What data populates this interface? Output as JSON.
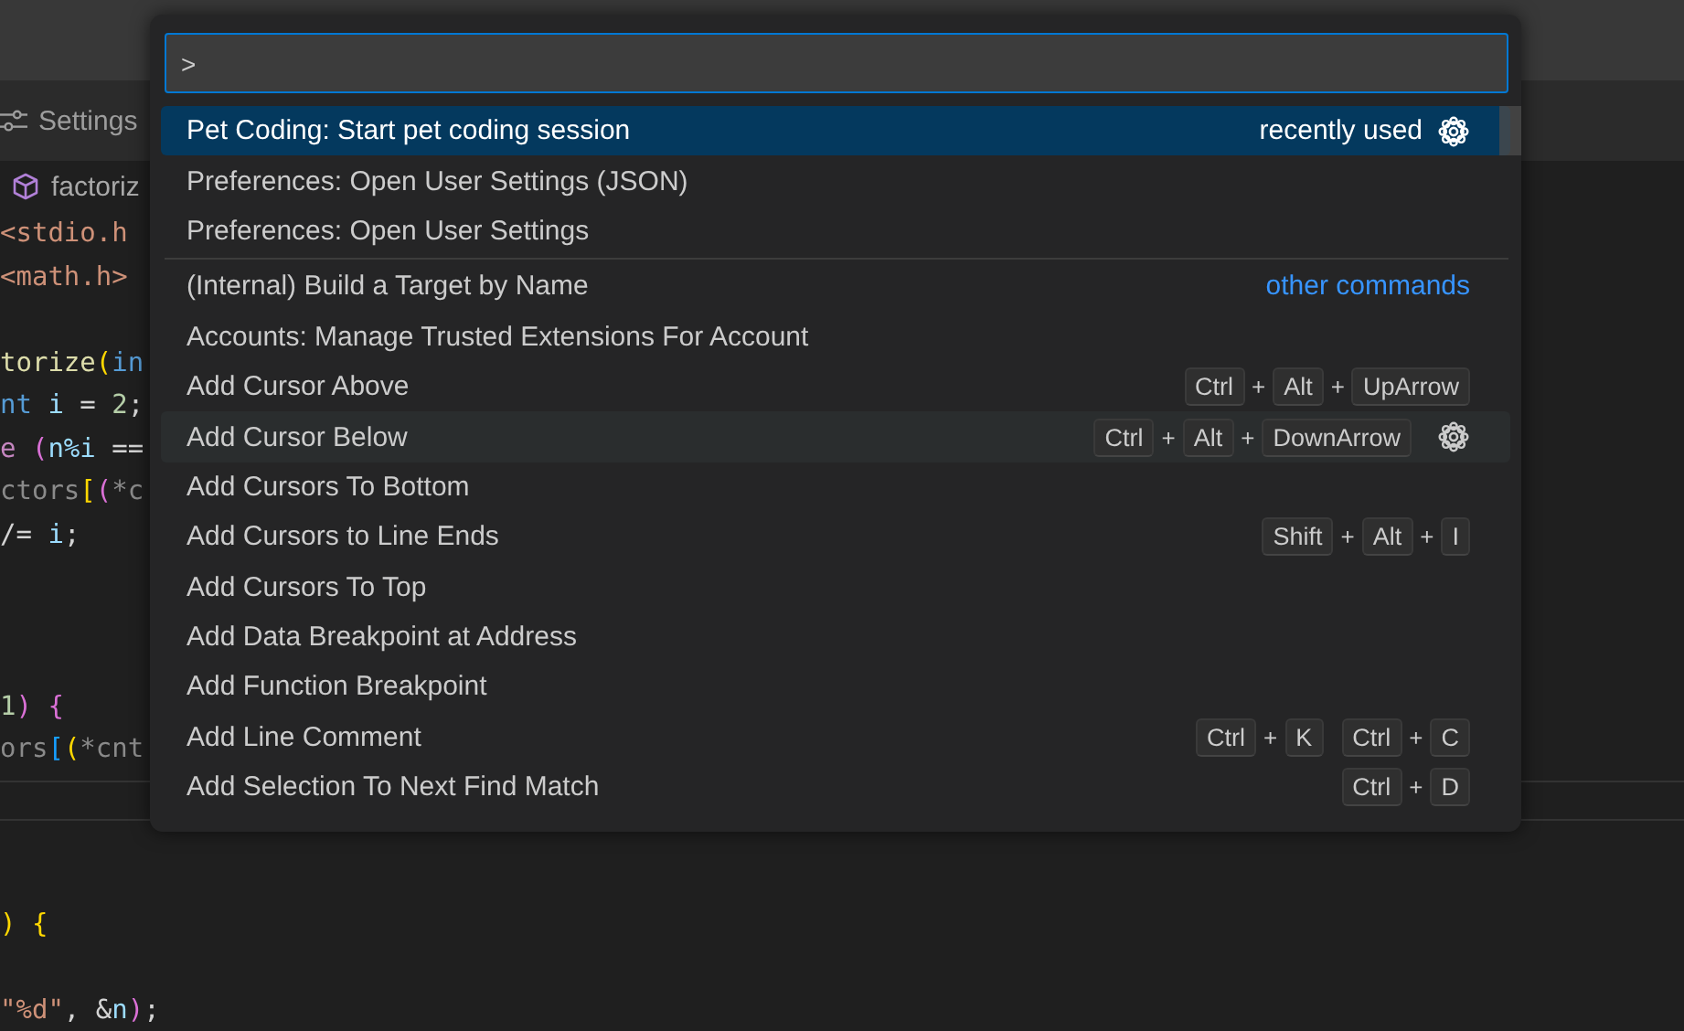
{
  "tab_bar": {
    "tabs": [
      {
        "label": "Settings",
        "selected": false
      }
    ]
  },
  "breadcrumb": {
    "file": "factoriz"
  },
  "editor": {
    "lines_top": [
      {
        "kind": "code",
        "tokens": [
          {
            "text": "<stdio.h",
            "kind": "string"
          }
        ]
      },
      {
        "kind": "code",
        "tokens": [
          {
            "text": "<math.h>",
            "kind": "string"
          }
        ]
      },
      {
        "kind": "blank"
      },
      {
        "kind": "code",
        "tokens": [
          {
            "text": "torize",
            "kind": "function"
          },
          {
            "text": "(",
            "kind": "bracket1"
          },
          {
            "text": "in",
            "kind": "keyword"
          }
        ]
      },
      {
        "kind": "code",
        "tokens": [
          {
            "text": "nt",
            "kind": "keyword"
          },
          {
            "text": " i",
            "kind": "variable"
          },
          {
            "text": " = ",
            "kind": "plain"
          },
          {
            "text": "2",
            "kind": "number"
          },
          {
            "text": ";",
            "kind": "plain"
          }
        ]
      },
      {
        "kind": "code",
        "tokens": [
          {
            "text": "e",
            "kind": "control"
          },
          {
            "text": " (",
            "kind": "bracket2"
          },
          {
            "text": "n%i",
            "kind": "variable"
          },
          {
            "text": " ==",
            "kind": "plain"
          }
        ]
      },
      {
        "kind": "code",
        "tokens": [
          {
            "text": "ctors",
            "kind": "dim"
          },
          {
            "text": "[",
            "kind": "bracket1"
          },
          {
            "text": "(",
            "kind": "bracket2"
          },
          {
            "text": "*c",
            "kind": "dim"
          }
        ]
      },
      {
        "kind": "code",
        "tokens": [
          {
            "text": "/=",
            "kind": "plain"
          },
          {
            "text": " i",
            "kind": "variable"
          },
          {
            "text": ";",
            "kind": "plain"
          }
        ]
      },
      {
        "kind": "blank"
      },
      {
        "kind": "blank"
      },
      {
        "kind": "blank"
      },
      {
        "kind": "code",
        "tokens": [
          {
            "text": "1",
            "kind": "number"
          },
          {
            "text": ")",
            "kind": "bracket2"
          },
          {
            "text": " {",
            "kind": "bracket2"
          }
        ]
      },
      {
        "kind": "code",
        "tokens": [
          {
            "text": "ors",
            "kind": "dim"
          },
          {
            "text": "[",
            "kind": "bracket3"
          },
          {
            "text": "(",
            "kind": "bracket1"
          },
          {
            "text": "*cnt",
            "kind": "dim"
          }
        ]
      }
    ],
    "lines_bottom": [
      {
        "kind": "code",
        "tokens": [
          {
            "text": ")",
            "kind": "bracket1"
          },
          {
            "text": " {",
            "kind": "bracket1"
          }
        ]
      },
      {
        "kind": "blank"
      },
      {
        "kind": "code",
        "tokens": [
          {
            "text": "\"%d\"",
            "kind": "string"
          },
          {
            "text": ", &",
            "kind": "plain"
          },
          {
            "text": "n",
            "kind": "variable"
          },
          {
            "text": ")",
            "kind": "bracket2"
          },
          {
            "text": ";",
            "kind": "plain"
          }
        ]
      }
    ]
  },
  "palette": {
    "input": {
      "value": ">"
    },
    "key_joiner": "+",
    "items": [
      {
        "label": "Pet Coding: Start pet coding session",
        "selected": true,
        "hovered": false,
        "separator_before": false,
        "detail": "recently used"
      },
      {
        "label": "Preferences: Open User Settings (JSON)",
        "selected": false,
        "hovered": false,
        "separator_before": false
      },
      {
        "label": "Preferences: Open User Settings",
        "selected": false,
        "hovered": false,
        "separator_before": false
      },
      {
        "label": "(Internal) Build a Target by Name",
        "selected": false,
        "hovered": false,
        "separator_before": true,
        "detail": "other commands"
      },
      {
        "label": "Accounts: Manage Trusted Extensions For Account",
        "selected": false,
        "hovered": false,
        "separator_before": false
      },
      {
        "label": "Add Cursor Above",
        "selected": false,
        "hovered": false,
        "separator_before": false,
        "keybinding": [
          [
            "Ctrl",
            "Alt",
            "UpArrow"
          ]
        ]
      },
      {
        "label": "Add Cursor Below",
        "selected": false,
        "hovered": true,
        "separator_before": false,
        "keybinding": [
          [
            "Ctrl",
            "Alt",
            "DownArrow"
          ]
        ]
      },
      {
        "label": "Add Cursors To Bottom",
        "selected": false,
        "hovered": false,
        "separator_before": false
      },
      {
        "label": "Add Cursors to Line Ends",
        "selected": false,
        "hovered": false,
        "separator_before": false,
        "keybinding": [
          [
            "Shift",
            "Alt",
            "I"
          ]
        ]
      },
      {
        "label": "Add Cursors To Top",
        "selected": false,
        "hovered": false,
        "separator_before": false
      },
      {
        "label": "Add Data Breakpoint at Address",
        "selected": false,
        "hovered": false,
        "separator_before": false
      },
      {
        "label": "Add Function Breakpoint",
        "selected": false,
        "hovered": false,
        "separator_before": false
      },
      {
        "label": "Add Line Comment",
        "selected": false,
        "hovered": false,
        "separator_before": false,
        "keybinding": [
          [
            "Ctrl",
            "K"
          ],
          [
            "Ctrl",
            "C"
          ]
        ]
      },
      {
        "label": "Add Selection To Next Find Match",
        "selected": false,
        "hovered": false,
        "separator_before": false,
        "keybinding": [
          [
            "Ctrl",
            "D"
          ]
        ]
      }
    ]
  }
}
